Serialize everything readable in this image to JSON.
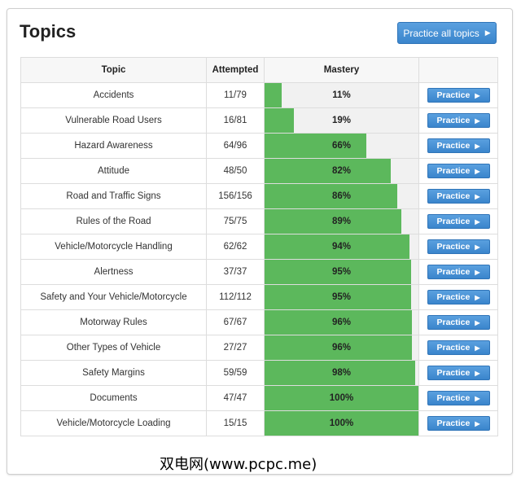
{
  "header": {
    "title": "Topics",
    "practice_all_label": "Practice all topics",
    "practice_all_icon": "play-arrow-icon"
  },
  "table": {
    "columns": [
      "Topic",
      "Attempted",
      "Mastery",
      ""
    ],
    "practice_label": "Practice",
    "bar_color": "#5cb85c",
    "button_color": "#428bca",
    "rows": [
      {
        "topic": "Accidents",
        "attempted": "11/79",
        "mastery": 11,
        "mastery_label": "11%"
      },
      {
        "topic": "Vulnerable Road Users",
        "attempted": "16/81",
        "mastery": 19,
        "mastery_label": "19%"
      },
      {
        "topic": "Hazard Awareness",
        "attempted": "64/96",
        "mastery": 66,
        "mastery_label": "66%"
      },
      {
        "topic": "Attitude",
        "attempted": "48/50",
        "mastery": 82,
        "mastery_label": "82%"
      },
      {
        "topic": "Road and Traffic Signs",
        "attempted": "156/156",
        "mastery": 86,
        "mastery_label": "86%"
      },
      {
        "topic": "Rules of the Road",
        "attempted": "75/75",
        "mastery": 89,
        "mastery_label": "89%"
      },
      {
        "topic": "Vehicle/Motorcycle Handling",
        "attempted": "62/62",
        "mastery": 94,
        "mastery_label": "94%"
      },
      {
        "topic": "Alertness",
        "attempted": "37/37",
        "mastery": 95,
        "mastery_label": "95%"
      },
      {
        "topic": "Safety and Your Vehicle/Motorcycle",
        "attempted": "112/112",
        "mastery": 95,
        "mastery_label": "95%"
      },
      {
        "topic": "Motorway Rules",
        "attempted": "67/67",
        "mastery": 96,
        "mastery_label": "96%"
      },
      {
        "topic": "Other Types of Vehicle",
        "attempted": "27/27",
        "mastery": 96,
        "mastery_label": "96%"
      },
      {
        "topic": "Safety Margins",
        "attempted": "59/59",
        "mastery": 98,
        "mastery_label": "98%"
      },
      {
        "topic": "Documents",
        "attempted": "47/47",
        "mastery": 100,
        "mastery_label": "100%"
      },
      {
        "topic": "Vehicle/Motorcycle Loading",
        "attempted": "15/15",
        "mastery": 100,
        "mastery_label": "100%"
      }
    ]
  },
  "watermark": "双电网(www.pcpc.me)"
}
